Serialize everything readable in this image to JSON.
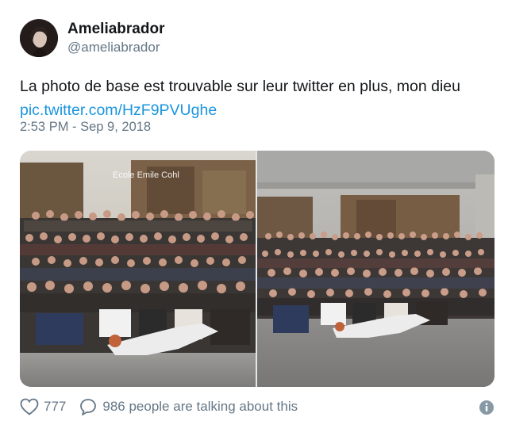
{
  "author": {
    "display_name": "Ameliabrador",
    "handle": "@ameliabrador"
  },
  "tweet": {
    "text": "La photo de base est trouvable sur leur twitter en plus, mon dieu",
    "link": "pic.twitter.com/HzF9PVUghe",
    "timestamp": "2:53 PM - Sep 9, 2018"
  },
  "media": {
    "left_photo_caption": "Ecole Emile Cohl"
  },
  "actions": {
    "like_count": "777",
    "talking_text": "986 people are talking about this"
  },
  "colors": {
    "link": "#1b95e0",
    "secondary_text": "#657786",
    "primary_text": "#14171a"
  },
  "icons": {
    "like": "heart-icon",
    "reply": "speech-bubble-icon",
    "info": "info-icon"
  }
}
